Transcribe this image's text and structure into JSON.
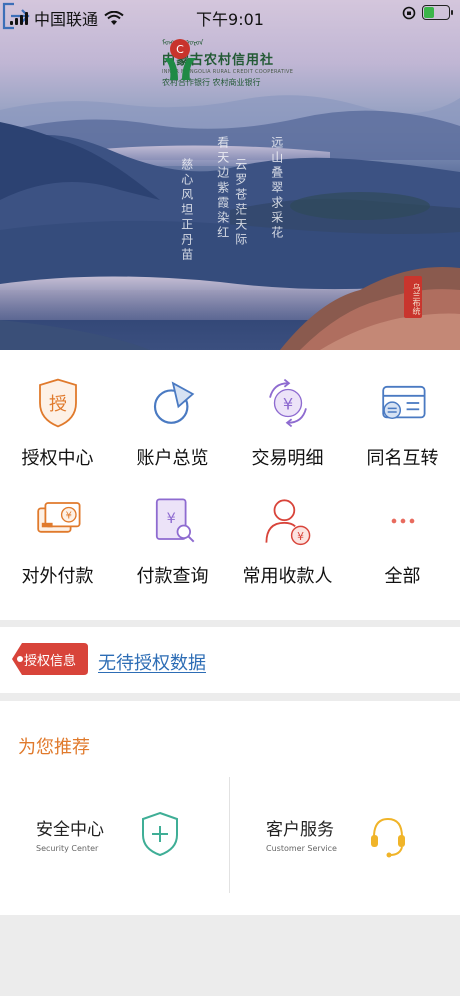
{
  "status_bar": {
    "carrier": "中国联通",
    "time": "下午9:01"
  },
  "header": {
    "bank_name": "内蒙古农村信用社",
    "bank_name_mongolian": "ᠮᠣᠩᠭᠣᠯ ᠣᠷᠣᠨ",
    "bank_name_en": "INNER MONGOLIA RURAL CREDIT COOPERATIVE",
    "bank_sub": "农村合作银行  农村商业银行",
    "poem_lines": [
      "看天边紫霞染红",
      "云罗苍茫天际",
      "慈心风坦正丹苗",
      "远山叠翠求采花"
    ],
    "seal_text": "乌兰布统"
  },
  "menu": [
    {
      "label": "授权中心",
      "icon": "authorization-shield-icon"
    },
    {
      "label": "账户总览",
      "icon": "account-pie-icon"
    },
    {
      "label": "交易明细",
      "icon": "transaction-yen-icon"
    },
    {
      "label": "同名互转",
      "icon": "transfer-card-icon"
    },
    {
      "label": "对外付款",
      "icon": "external-payment-icon"
    },
    {
      "label": "付款查询",
      "icon": "payment-query-icon"
    },
    {
      "label": "常用收款人",
      "icon": "payee-icon"
    },
    {
      "label": "全部",
      "icon": "more-dots-icon"
    }
  ],
  "auth_bar": {
    "tag_label": "授权信息",
    "link_text": "无待授权数据"
  },
  "recommend": {
    "title": "为您推荐",
    "cards": [
      {
        "title": "安全中心",
        "subtitle": "Security Center",
        "icon": "shield-plus-icon"
      },
      {
        "title": "客户服务",
        "subtitle": "Customer Service",
        "icon": "headset-icon"
      }
    ]
  },
  "colors": {
    "orange": "#e07a2c",
    "blue": "#4a7ac2",
    "purple": "#8e6bd0",
    "red": "#d8443a",
    "teal": "#3fae96",
    "yellow": "#f0b429",
    "link": "#2d6db5"
  }
}
